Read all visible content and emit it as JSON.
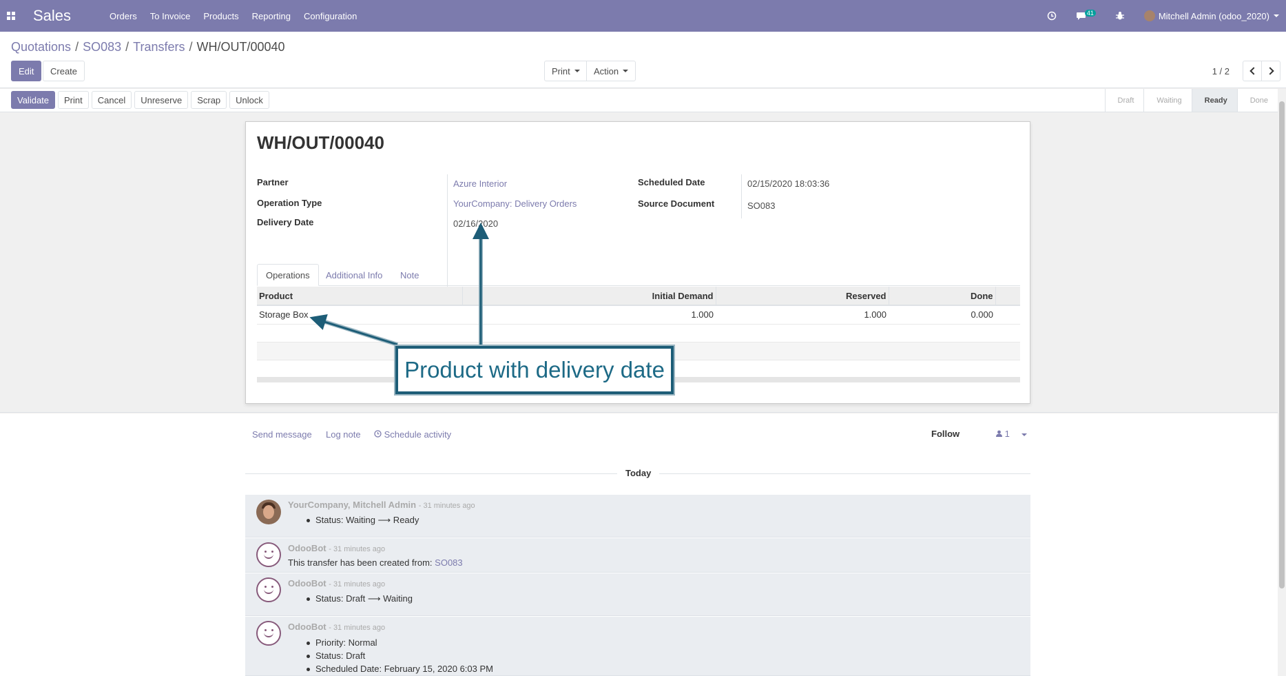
{
  "navbar": {
    "app_name": "Sales",
    "menu": [
      "Orders",
      "To Invoice",
      "Products",
      "Reporting",
      "Configuration"
    ],
    "message_count": "41",
    "user": "Mitchell Admin (odoo_2020)",
    "icons": [
      "apps-icon",
      "clock-icon",
      "chat-icon",
      "bug-icon"
    ]
  },
  "breadcrumb": {
    "items": [
      "Quotations",
      "SO083",
      "Transfers"
    ],
    "current": "WH/OUT/00040"
  },
  "control": {
    "edit_label": "Edit",
    "create_label": "Create",
    "print_label": "Print",
    "action_label": "Action",
    "pager": "1 / 2"
  },
  "statusbar": {
    "buttons": [
      "Validate",
      "Print",
      "Cancel",
      "Unreserve",
      "Scrap",
      "Unlock"
    ],
    "stages": [
      "Draft",
      "Waiting",
      "Ready",
      "Done"
    ],
    "active_stage": "Ready"
  },
  "form": {
    "title": "WH/OUT/00040",
    "partner_label": "Partner",
    "partner_value": "Azure Interior",
    "operation_type_label": "Operation Type",
    "operation_type_value": "YourCompany: Delivery Orders",
    "delivery_date_label": "Delivery Date",
    "delivery_date_value": "02/16/2020",
    "scheduled_date_label": "Scheduled Date",
    "scheduled_date_value": "02/15/2020 18:03:36",
    "source_document_label": "Source Document",
    "source_document_value": "SO083",
    "tabs": [
      "Operations",
      "Additional Info",
      "Note"
    ],
    "table": {
      "headers": [
        "Product",
        "Initial Demand",
        "Reserved",
        "Done"
      ],
      "rows": [
        {
          "product": "Storage Box",
          "initial_demand": "1.000",
          "reserved": "1.000",
          "done": "0.000"
        }
      ]
    }
  },
  "annotation": {
    "text": "Product with delivery date",
    "color": "#1d6a86"
  },
  "chatter": {
    "send_message": "Send message",
    "log_note": "Log note",
    "schedule_activity": "Schedule activity",
    "follow": "Follow",
    "followers": "1",
    "today": "Today",
    "messages": [
      {
        "author": "YourCompany, Mitchell Admin",
        "time": "- 31 minutes ago",
        "lines": [
          "Status: Waiting ⟶ Ready"
        ]
      },
      {
        "author": "OdooBot",
        "time": "- 31 minutes ago",
        "text_prefix": "This transfer has been created from:",
        "link": "SO083"
      },
      {
        "author": "OdooBot",
        "time": "- 31 minutes ago",
        "lines": [
          "Status: Draft ⟶ Waiting"
        ]
      },
      {
        "author": "OdooBot",
        "time": "- 31 minutes ago",
        "lines": [
          "Priority: Normal",
          "Status: Draft",
          "Scheduled Date: February 15, 2020 6:03 PM"
        ]
      }
    ]
  },
  "colors": {
    "brand": "#7c7bad",
    "annotation_border": "#1d5d77"
  }
}
